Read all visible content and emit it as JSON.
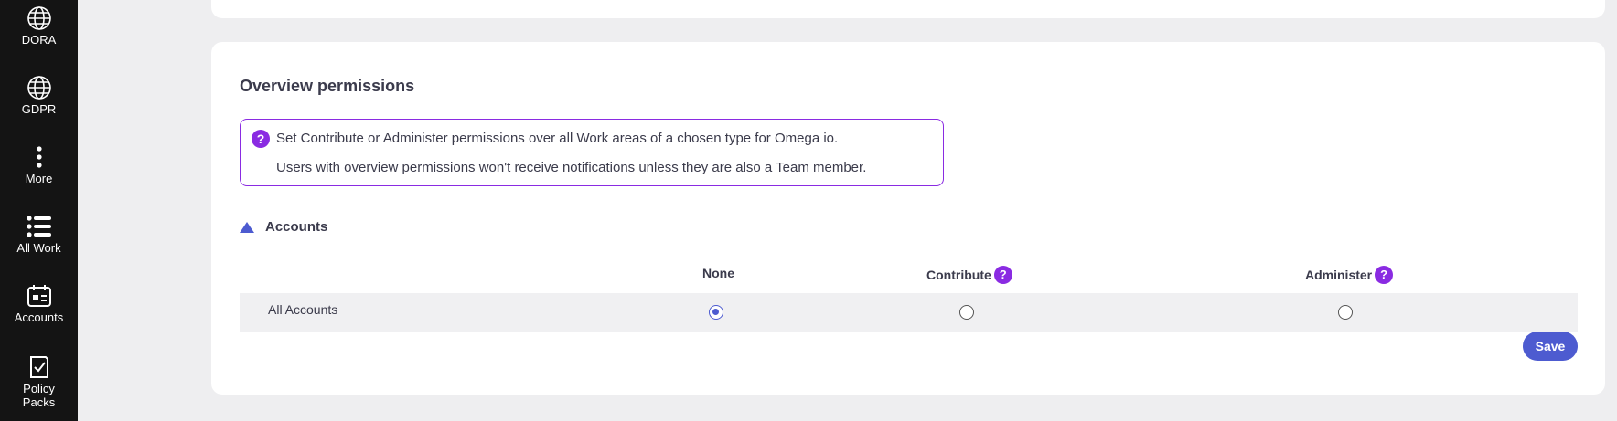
{
  "sidebar": {
    "items": [
      {
        "label": "DORA",
        "icon": "globe-icon"
      },
      {
        "label": "GDPR",
        "icon": "globe-icon"
      },
      {
        "label": "More",
        "icon": "more-vertical-icon"
      },
      {
        "label": "All Work",
        "icon": "list-icon"
      },
      {
        "label": "Accounts",
        "icon": "accounts-calendar-icon"
      },
      {
        "label": "Policy\nPacks",
        "icon": "policy-check-icon"
      }
    ]
  },
  "overview": {
    "title": "Overview permissions",
    "info_icon": "?",
    "info_line1": "Set Contribute or Administer permissions over all Work areas of a chosen type for Omega io.",
    "info_line2": "Users with overview permissions won't receive notifications unless they are also a Team member."
  },
  "accounts_section": {
    "label": "Accounts",
    "columns": {
      "none": "None",
      "contribute": "Contribute",
      "administer": "Administer"
    },
    "help_icon": "?",
    "rows": [
      {
        "label": "All Accounts",
        "selected": "None"
      }
    ]
  },
  "actions": {
    "save_label": "Save"
  },
  "colors": {
    "sidebar_bg": "#141414",
    "accent": "#4d5bd0",
    "help_purple": "#8a2be2",
    "page_bg": "#eeeef0"
  }
}
